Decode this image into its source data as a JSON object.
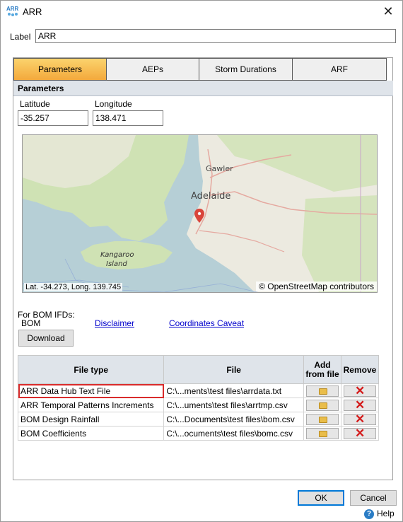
{
  "window": {
    "title": "ARR",
    "app_icon": "arr-app-icon",
    "close_symbol": "✕"
  },
  "label_field": {
    "label": "Label",
    "value": "ARR"
  },
  "tabs": [
    {
      "label": "Parameters",
      "active": true
    },
    {
      "label": "AEPs",
      "active": false
    },
    {
      "label": "Storm Durations",
      "active": false
    },
    {
      "label": "ARF",
      "active": false
    }
  ],
  "parameters": {
    "heading": "Parameters",
    "latitude_label": "Latitude",
    "latitude_value": "-35.257",
    "longitude_label": "Longitude",
    "longitude_value": "138.471"
  },
  "map": {
    "coord_readout": "Lat. -34.273, Long. 139.745",
    "attribution": "© OpenStreetMap contributors",
    "places": {
      "gawler": "Gawler",
      "adelaide": "Adelaide",
      "kangaroo1": "Kangaroo",
      "kangaroo2": "Island"
    },
    "colors": {
      "sea": "#b6cfd6",
      "land": "#eceae0",
      "green": "#cfe2b4",
      "marker": "#d9453b",
      "road": "#e5a9a0"
    }
  },
  "bom": {
    "for_bom_label": "For BOM IFDs:",
    "bom_label": "BOM",
    "disclaimer_link": "Disclaimer",
    "caveat_link": "Coordinates Caveat",
    "download_button": "Download"
  },
  "file_table": {
    "headers": {
      "file_type": "File type",
      "file": "File",
      "add_line1": "Add",
      "add_line2": "from file",
      "remove": "Remove"
    },
    "rows": [
      {
        "type": "ARR Data Hub Text File",
        "file": "C:\\...ments\\test files\\arrdata.txt",
        "selected": true
      },
      {
        "type": "ARR Temporal Patterns Increments",
        "file": "C:\\...uments\\test files\\arrtmp.csv",
        "selected": false
      },
      {
        "type": "BOM Design Rainfall",
        "file": "C:\\...Documents\\test files\\bom.csv",
        "selected": false
      },
      {
        "type": "BOM Coefficients",
        "file": "C:\\...ocuments\\test files\\bomc.csv",
        "selected": false
      }
    ]
  },
  "footer": {
    "ok_button": "OK",
    "cancel_button": "Cancel",
    "help_label": "Help",
    "help_symbol": "?"
  }
}
